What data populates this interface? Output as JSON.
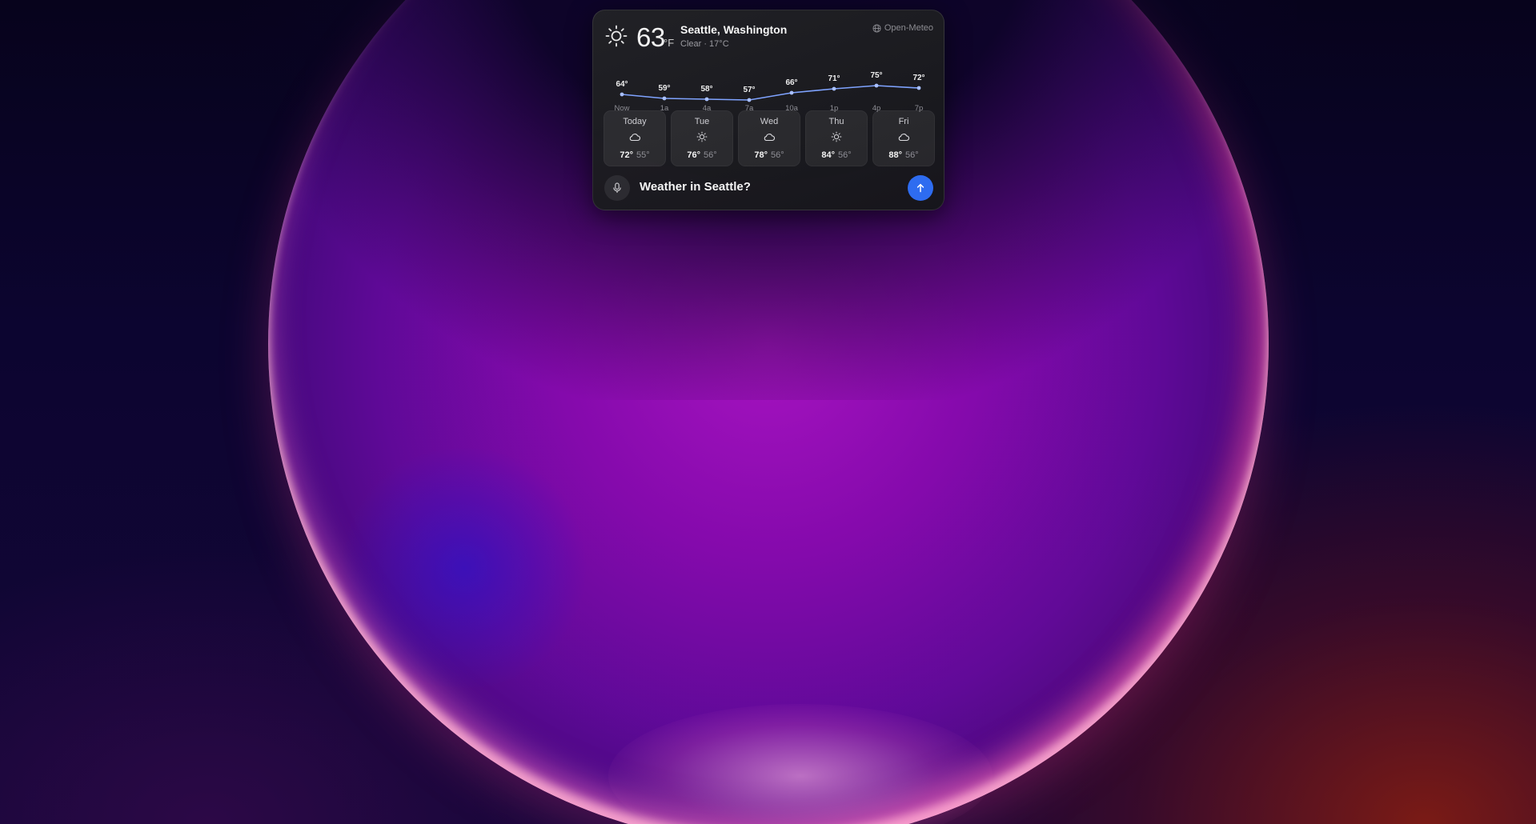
{
  "current": {
    "temperature": "63",
    "unit": "°F",
    "location": "Seattle, Washington",
    "condition": "Clear · 17°C",
    "source": "Open-Meteo",
    "icon": "sun-icon"
  },
  "hourly": [
    {
      "time": "Now",
      "temp": "64°",
      "value": 64
    },
    {
      "time": "1a",
      "temp": "59°",
      "value": 59
    },
    {
      "time": "4a",
      "temp": "58°",
      "value": 58
    },
    {
      "time": "7a",
      "temp": "57°",
      "value": 57
    },
    {
      "time": "10a",
      "temp": "66°",
      "value": 66
    },
    {
      "time": "1p",
      "temp": "71°",
      "value": 71
    },
    {
      "time": "4p",
      "temp": "75°",
      "value": 75
    },
    {
      "time": "7p",
      "temp": "72°",
      "value": 72
    }
  ],
  "daily": [
    {
      "day": "Today",
      "icon": "cloud-icon",
      "high": "72°",
      "low": "55°"
    },
    {
      "day": "Tue",
      "icon": "sun-icon",
      "high": "76°",
      "low": "56°"
    },
    {
      "day": "Wed",
      "icon": "cloud-icon",
      "high": "78°",
      "low": "56°"
    },
    {
      "day": "Thu",
      "icon": "sun-icon",
      "high": "84°",
      "low": "56°"
    },
    {
      "day": "Fri",
      "icon": "cloud-icon",
      "high": "88°",
      "low": "56°"
    }
  ],
  "prompt": {
    "query": "Weather in Seattle?"
  },
  "colors": {
    "accent": "#2e6cf0",
    "line": "#7fa3ff"
  }
}
